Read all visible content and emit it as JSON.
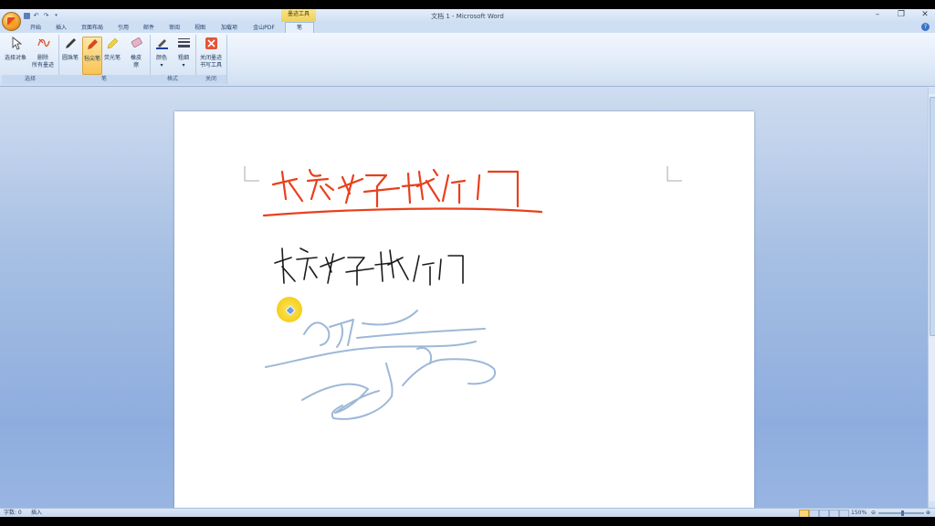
{
  "window": {
    "title": "文档 1 - Microsoft Word",
    "context_tab_group": "墨迹工具"
  },
  "qat": {
    "undo_icon": "undo-icon",
    "redo_icon": "redo-icon",
    "save_icon": "save-icon"
  },
  "tabs": [
    "开始",
    "插入",
    "页面布局",
    "引用",
    "邮件",
    "审阅",
    "视图",
    "加载项",
    "金山PDF",
    "笔"
  ],
  "active_tab": "笔",
  "ribbon": {
    "groups": {
      "select": "选择",
      "pens": "笔",
      "format": "格式",
      "close": "关闭"
    },
    "buttons": {
      "select_objects": "选择对象",
      "delete_all_ink": "删除\n所有墨迹",
      "ballpoint": "圆珠笔",
      "felt_tip": "毡尖笔",
      "highlighter": "荧光笔",
      "eraser": "橡皮\n擦",
      "color": "颜色",
      "thickness": "粗细",
      "close_ink": "关闭墨迹\n书写工具"
    }
  },
  "statusbar": {
    "word_count": "字数: 0",
    "mode": "插入",
    "zoom": "150%"
  },
  "colors": {
    "ink_red": "#e8401c",
    "ink_black": "#1a1a1a",
    "ink_blue": "#9db8d8",
    "ribbon_active": "#f9c454"
  }
}
